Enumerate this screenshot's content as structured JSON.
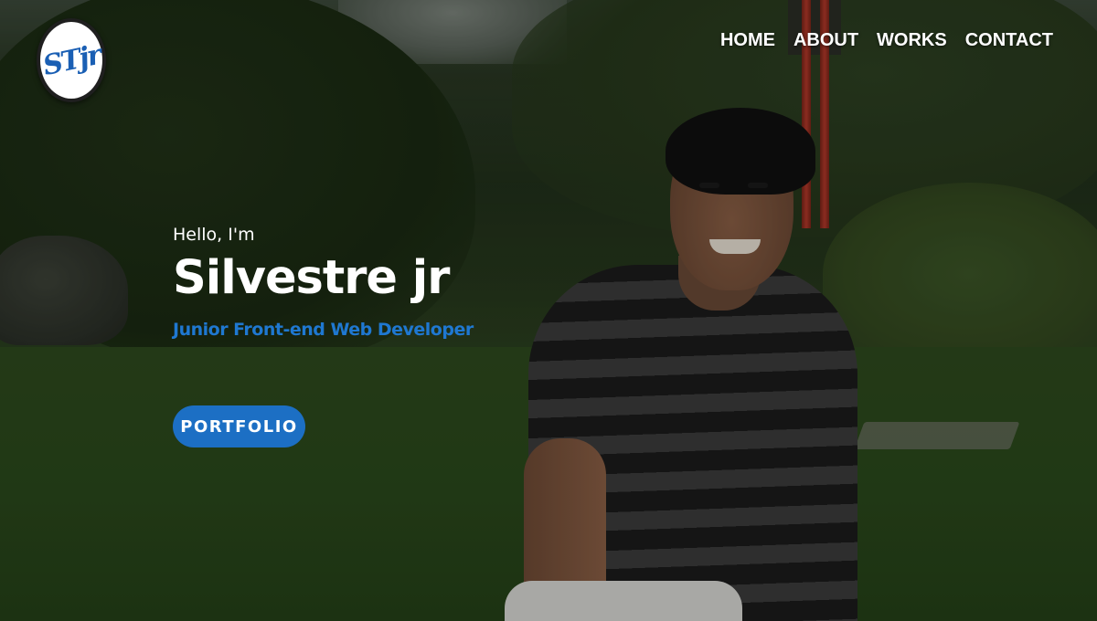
{
  "brand": {
    "logo_text": "STjr"
  },
  "nav": {
    "items": [
      {
        "label": "HOME"
      },
      {
        "label": "ABOUT"
      },
      {
        "label": "WORKS"
      },
      {
        "label": "CONTACT"
      }
    ]
  },
  "hero": {
    "greeting": "Hello, I'm",
    "name": "Silvestre jr",
    "role": "Junior Front-end Web Developer",
    "cta_label": "PORTFOLIO"
  },
  "colors": {
    "accent": "#1c6fc4",
    "role_text": "#1f78d1",
    "nav_text": "#ffffff"
  }
}
